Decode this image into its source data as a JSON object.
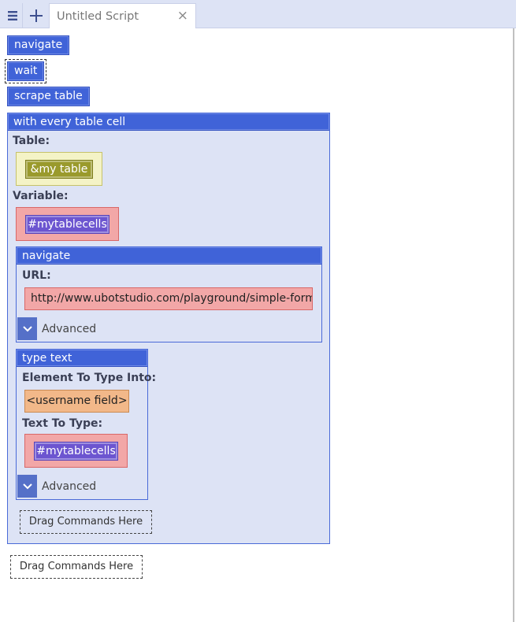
{
  "tab": {
    "title": "Untitled Script",
    "close": "×"
  },
  "commands": {
    "navigate": "navigate",
    "wait": "wait",
    "scrape_table": "scrape table"
  },
  "loop": {
    "header": "with every table cell",
    "table_label": "Table:",
    "table_value": "&my table",
    "variable_label": "Variable:",
    "variable_value": "#mytablecells",
    "navigate": {
      "header": "navigate",
      "url_label": "URL:",
      "url_value": "http://www.ubotstudio.com/playground/simple-form",
      "advanced": "Advanced"
    },
    "type_text": {
      "header": "type text",
      "element_label": "Element To Type Into:",
      "element_value": "<username field>",
      "text_label": "Text To Type:",
      "text_value": "#mytablecells",
      "advanced": "Advanced"
    },
    "drop_zone": "Drag Commands Here"
  },
  "drop_zone": "Drag Commands Here",
  "colors": {
    "command_blue": "#4063d8",
    "block_bg": "#dde3f5",
    "table_chip": "#9a9a2c",
    "variable_chip": "#6c55d0",
    "url_field": "#f2a7a7",
    "element_chip": "#f2b889"
  }
}
